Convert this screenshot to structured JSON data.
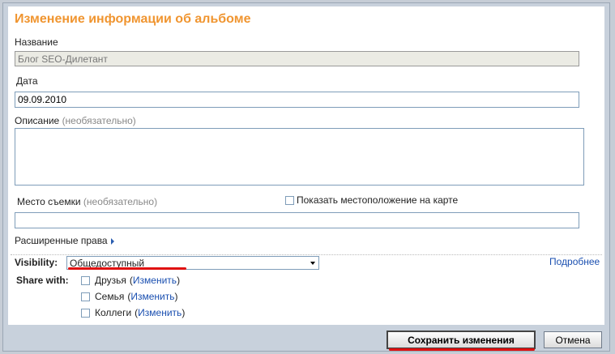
{
  "title": "Изменение информации об альбоме",
  "name_field": {
    "label": "Название",
    "value": "Блог SEO-Дилетант"
  },
  "date_field": {
    "label": "Дата",
    "value": "09.09.2010"
  },
  "description": {
    "label": "Описание",
    "optional": "(необязательно)",
    "value": ""
  },
  "location": {
    "label": "Место съемки",
    "optional": "(необязательно)",
    "value": "",
    "show_map_label": "Показать местоположение на карте"
  },
  "advanced_rights": {
    "label": "Расширенные права"
  },
  "visibility": {
    "label": "Visibility:",
    "value": "Общедоступный",
    "more_link": "Подробнее"
  },
  "share": {
    "label": "Share with:",
    "change_label": "Изменить",
    "items": [
      {
        "name": "Друзья"
      },
      {
        "name": "Семья"
      },
      {
        "name": "Коллеги"
      }
    ]
  },
  "buttons": {
    "save": "Сохранить изменения",
    "cancel": "Отмена"
  },
  "colors": {
    "title": "#f09530",
    "link": "#1a4fb0",
    "highlight": "#e01010"
  }
}
